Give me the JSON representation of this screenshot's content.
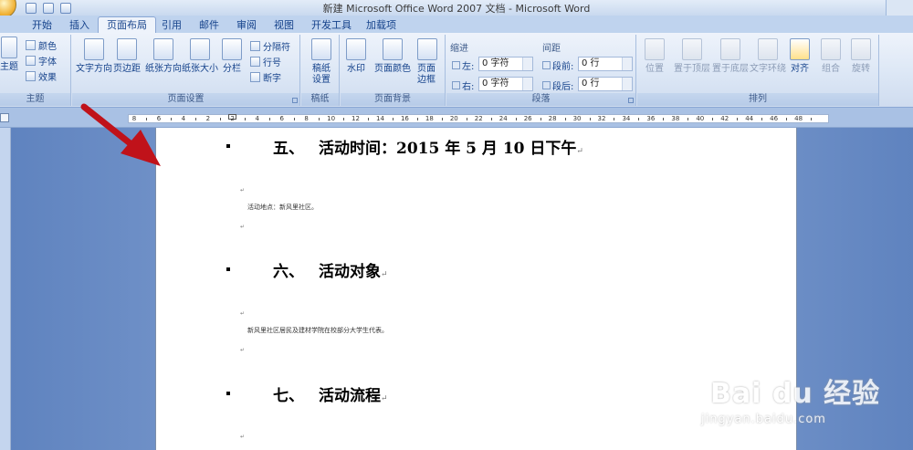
{
  "window": {
    "title": "新建 Microsoft Office Word 2007 文档 - Microsoft Word"
  },
  "tabs": [
    {
      "label": "开始"
    },
    {
      "label": "插入"
    },
    {
      "label": "页面布局",
      "active": true
    },
    {
      "label": "引用"
    },
    {
      "label": "邮件"
    },
    {
      "label": "审阅"
    },
    {
      "label": "视图"
    },
    {
      "label": "开发工具"
    },
    {
      "label": "加载项"
    }
  ],
  "ribbon": {
    "theme_group": {
      "label": "主题",
      "theme_btn": "主题",
      "colors": "颜色",
      "fonts": "字体",
      "effects": "效果"
    },
    "page_setup": {
      "label": "页面设置",
      "text_direction": "文字方向",
      "margins": "页边距",
      "orientation": "纸张方向",
      "size": "纸张大小",
      "columns": "分栏",
      "breaks": "分隔符",
      "line_numbers": "行号",
      "hyphenation": "断字"
    },
    "draft": {
      "label": "稿纸",
      "btn": "稿纸设置"
    },
    "page_background": {
      "label": "页面背景",
      "watermark": "水印",
      "page_color": "页面颜色",
      "page_borders": "页面边框"
    },
    "paragraph": {
      "label": "段落",
      "indent_head": "缩进",
      "spacing_head": "间距",
      "left_label": "左:",
      "left_value": "0 字符",
      "right_label": "右:",
      "right_value": "0 字符",
      "before_label": "段前:",
      "before_value": "0 行",
      "after_label": "段后:",
      "after_value": "0 行"
    },
    "arrange": {
      "label": "排列",
      "position": "位置",
      "bring_front": "置于顶层",
      "send_back": "置于底层",
      "text_wrap": "文字环绕",
      "align": "对齐",
      "group": "组合",
      "rotate": "旋转"
    }
  },
  "ruler": {
    "marks": [
      "8",
      "6",
      "4",
      "2",
      "2",
      "4",
      "6",
      "8",
      "10",
      "12",
      "14",
      "16",
      "18",
      "20",
      "22",
      "24",
      "26",
      "28",
      "30",
      "32",
      "34",
      "36",
      "38",
      "40",
      "42",
      "44",
      "46",
      "48"
    ]
  },
  "document": {
    "h5": {
      "num": "五、",
      "text": "活动时间：2015 年 5 月 10 日下午"
    },
    "p5": "活动地点：新风里社区。",
    "h6": {
      "num": "六、",
      "text": "活动对象"
    },
    "p6": "新风里社区居民及建材学院在校部分大学生代表。",
    "h7": {
      "num": "七、",
      "text": "活动流程"
    },
    "pilcrow": "↵",
    "small_mark": "↵"
  },
  "watermark": {
    "brand": "Bai du 经验",
    "url": "jingyan.baidu.com"
  },
  "colors": {
    "arrow": "#c0121a",
    "ribbon_text": "#15428b"
  }
}
